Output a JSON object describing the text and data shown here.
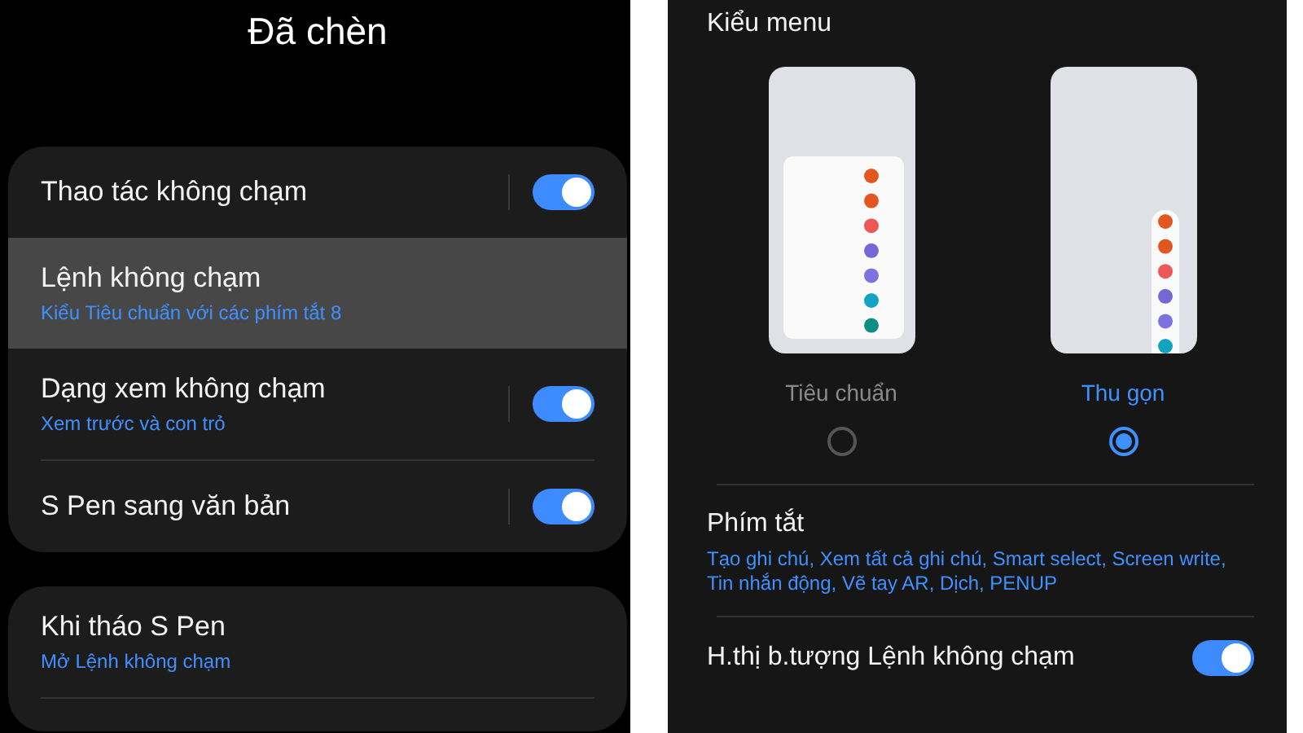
{
  "left_screen": {
    "title": "Đã chèn",
    "groups": [
      {
        "items": [
          {
            "kind": "toggle",
            "title": "Thao tác không chạm",
            "on": true,
            "highlighted": false
          },
          {
            "kind": "link",
            "title": "Lệnh không chạm",
            "subtitle": "Kiểu Tiêu chuẩn với các phím tắt 8",
            "highlighted": true
          },
          {
            "kind": "toggle",
            "title": "Dạng xem không chạm",
            "subtitle": "Xem trước và con trỏ",
            "on": true,
            "highlighted": false
          },
          {
            "kind": "toggle",
            "title": "S Pen sang văn bản",
            "on": true,
            "highlighted": false
          }
        ]
      },
      {
        "items": [
          {
            "kind": "link",
            "title": "Khi tháo S Pen",
            "subtitle": "Mở Lệnh không chạm",
            "highlighted": false
          }
        ]
      }
    ]
  },
  "right_screen": {
    "section_title": "Kiểu menu",
    "menu_styles": [
      {
        "kind": "standard",
        "label": "Tiêu chuẩn",
        "selected": false
      },
      {
        "kind": "compact",
        "label": "Thu gọn",
        "selected": true
      }
    ],
    "shortcuts": {
      "title": "Phím tắt",
      "list": "Tạo ghi chú, Xem tất cả ghi chú, Smart select, Screen write, Tin nhắn động, Vẽ tay AR, Dịch, PENUP"
    },
    "icon_toggle": {
      "label": "H.thị b.tượng Lệnh không chạm",
      "on": true
    }
  }
}
